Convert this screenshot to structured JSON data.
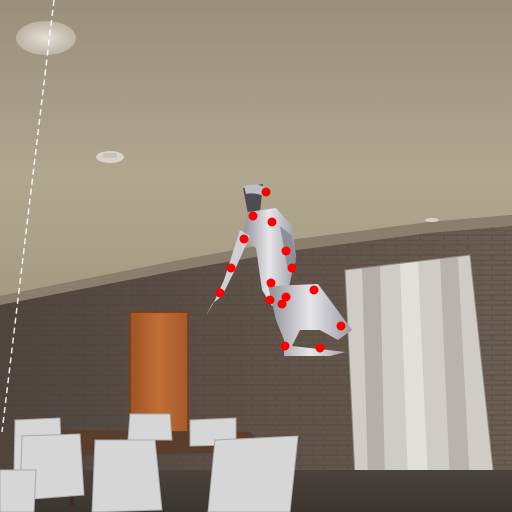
{
  "scene": {
    "description_labels": [],
    "overlay": {
      "keypoint_color": "#ff0000",
      "guide_line_color": "#ffffff",
      "keypoint_count": 21
    },
    "palette": {
      "ceiling": "#a89c86",
      "ceiling_light": "#c2b8a3",
      "wall_brick": "#5c5048",
      "door": "#b5642e",
      "curtain_light": "#d8d4cf",
      "curtain_dark": "#b5b0aa",
      "figure_metal": "#c9c9cf",
      "floor": "#4a433c",
      "chair": "#d9d9d9",
      "table": "#5a3e2c"
    }
  }
}
